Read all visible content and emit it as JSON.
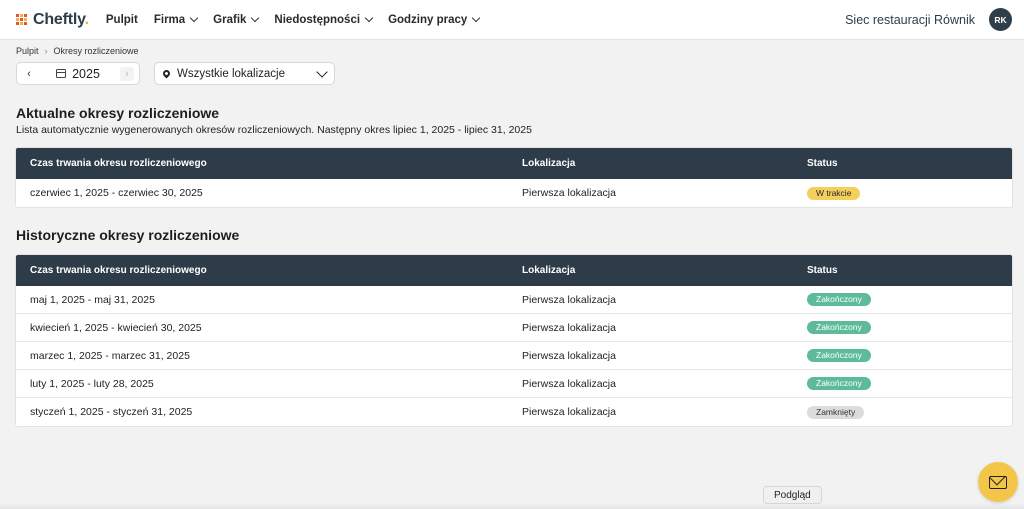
{
  "brand": {
    "name": "Cheftly",
    "accent": "#f0b43a"
  },
  "nav": {
    "items": [
      {
        "label": "Pulpit",
        "dropdown": false
      },
      {
        "label": "Firma",
        "dropdown": true
      },
      {
        "label": "Grafik",
        "dropdown": true
      },
      {
        "label": "Niedostępności",
        "dropdown": true
      },
      {
        "label": "Godziny pracy",
        "dropdown": true
      }
    ]
  },
  "header": {
    "org_name": "Siec restauracji Równik",
    "avatar_initials": "RK"
  },
  "breadcrumb": {
    "home": "Pulpit",
    "current": "Okresy rozliczeniowe"
  },
  "filters": {
    "year": "2025",
    "location": "Wszystkie lokalizacje"
  },
  "current": {
    "title": "Aktualne okresy rozliczeniowe",
    "description": "Lista automatycznie wygenerowanych okresów rozliczeniowych. Następny okres lipiec 1, 2025 - lipiec 31, 2025",
    "columns": [
      "Czas trwania okresu rozliczeniowego",
      "Lokalizacja",
      "Status"
    ],
    "rows": [
      {
        "period": "czerwiec 1, 2025 - czerwiec 30, 2025",
        "location": "Pierwsza lokalizacja",
        "status": "W trakcie",
        "status_color": "#f3cf5b"
      }
    ]
  },
  "history": {
    "title": "Historyczne okresy rozliczeniowe",
    "columns": [
      "Czas trwania okresu rozliczeniowego",
      "Lokalizacja",
      "Status"
    ],
    "rows": [
      {
        "period": "maj 1, 2025 - maj 31, 2025",
        "location": "Pierwsza lokalizacja",
        "status": "Zakończony",
        "status_color": "#5dbb99"
      },
      {
        "period": "kwiecień 1, 2025 - kwiecień 30, 2025",
        "location": "Pierwsza lokalizacja",
        "status": "Zakończony",
        "status_color": "#5dbb99"
      },
      {
        "period": "marzec 1, 2025 - marzec 31, 2025",
        "location": "Pierwsza lokalizacja",
        "status": "Zakończony",
        "status_color": "#5dbb99"
      },
      {
        "period": "luty 1, 2025 - luty 28, 2025",
        "location": "Pierwsza lokalizacja",
        "status": "Zakończony",
        "status_color": "#5dbb99"
      },
      {
        "period": "styczeń 1, 2025 - styczeń 31, 2025",
        "location": "Pierwsza lokalizacja",
        "status": "Zamknięty",
        "status_color": "#dcdcdf"
      }
    ]
  },
  "tooltip": {
    "label": "Podgląd"
  },
  "fab": {
    "icon": "mail-icon",
    "color": "#f3c649"
  }
}
